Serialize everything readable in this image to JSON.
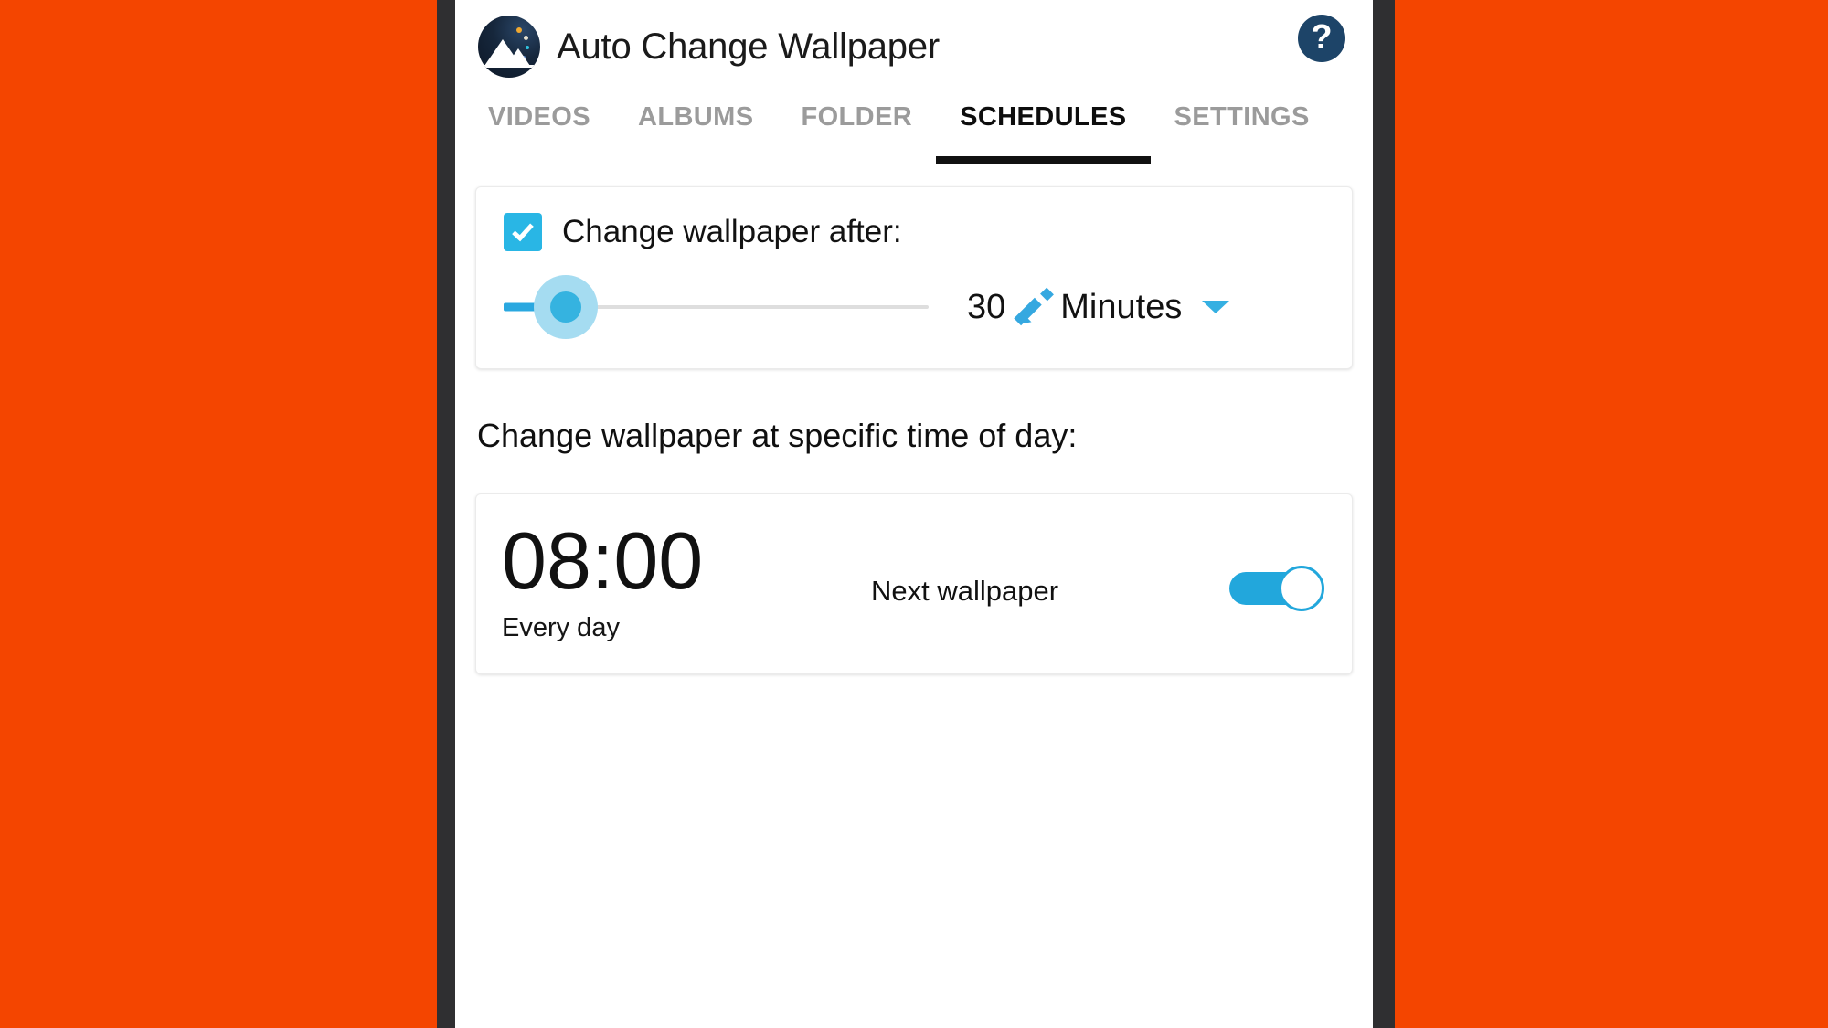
{
  "theme": {
    "background": "#F44500",
    "bezel": "#2f2f31",
    "screen": "#ffffff",
    "accent": "#29b6e5",
    "accent_dark": "#22a7dc",
    "help_circle": "#1d4468",
    "active_tab": "#0d0d0d",
    "inactive_tab": "#9b9b9b"
  },
  "appbar": {
    "icon_name": "app-logo-mountain-icon",
    "title": "Auto Change Wallpaper",
    "help_icon": "help-question-icon",
    "help_glyph": "?"
  },
  "tabs": {
    "items": [
      {
        "id": "videos",
        "label": "VIDEOS",
        "active": false
      },
      {
        "id": "albums",
        "label": "ALBUMS",
        "active": false
      },
      {
        "id": "folder",
        "label": "FOLDER",
        "active": false
      },
      {
        "id": "schedules",
        "label": "SCHEDULES",
        "active": true
      },
      {
        "id": "settings",
        "label": "SETTINGS",
        "active": false
      }
    ],
    "active_index": 3
  },
  "interval_card": {
    "checkbox_icon": "checkbox-checked-icon",
    "checkbox_checked": true,
    "label": "Change wallpaper after:",
    "slider": {
      "value": 30,
      "min": 1,
      "max": 1440,
      "fill_percent": 15
    },
    "duration_value": "30",
    "edit_icon": "pencil-edit-icon",
    "unit": "Minutes",
    "dropdown_icon": "chevron-down-icon"
  },
  "specific_time": {
    "section_title": "Change wallpaper at specific time of day:",
    "schedules": [
      {
        "time": "08:00",
        "repeat": "Every day",
        "action": "Next wallpaper",
        "enabled": true,
        "toggle_icon": "toggle-switch-on-icon"
      }
    ]
  }
}
